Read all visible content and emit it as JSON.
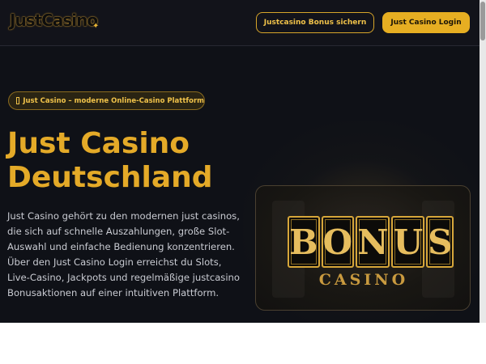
{
  "header": {
    "logo_text": "JustCasino",
    "bonus_button_label": "Justcasino Bonus sichern",
    "login_button_label": "Just Casino Login"
  },
  "hero": {
    "badge_text": "Just Casino – moderne Online-Casino Plattform",
    "title_line1": "Just Casino",
    "title_line2": "Deutschland",
    "description": "Just Casino gehört zu den modernen just casinos, die sich auf schnelle Auszahlungen, große Slot-Auswahl und einfache Bedienung konzentrieren. Über den Just Casino Login erreichst du Slots, Live-Casino, Jackpots und regelmäßige justcasino Bonusaktionen auf einer intuitiven Plattform."
  },
  "promo_card": {
    "letters": [
      "B",
      "O",
      "N",
      "U",
      "S"
    ],
    "subtitle": "CASINO"
  },
  "colors": {
    "accent_gold": "#e4aa28",
    "background": "#0f1117"
  },
  "icons": {
    "logo_star": "sparkle-icon",
    "badge_icon": "badge-icon"
  }
}
